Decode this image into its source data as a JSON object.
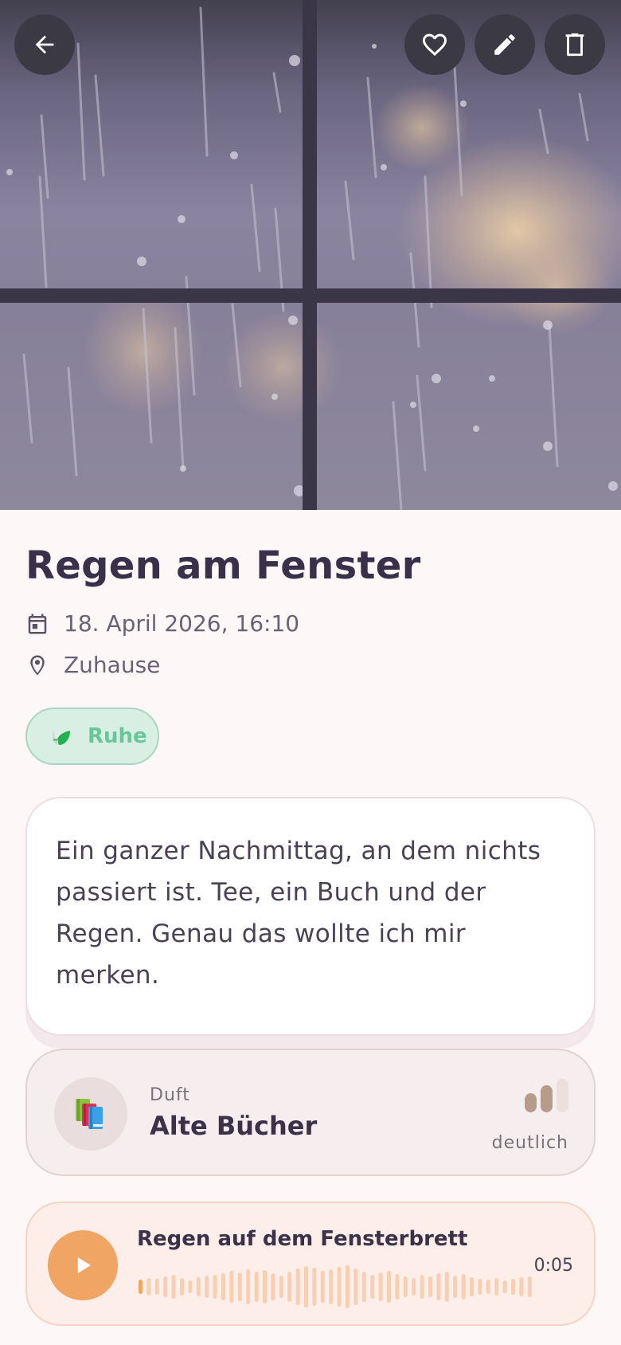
{
  "header": {
    "back_icon": "arrow-left-icon",
    "favorite_icon": "heart-outline-icon",
    "edit_icon": "pencil-icon",
    "delete_icon": "trash-icon"
  },
  "memory": {
    "title": "Regen am Fenster",
    "date": "18. April 2026, 16:10",
    "place": "Zuhause",
    "mood_tag": "Ruhe",
    "note": "Ein ganzer Nachmittag, an dem nichts passiert ist. Tee, ein Buch und der Regen. Genau das wollte ich mir merken."
  },
  "scent": {
    "kind_label": "Duft",
    "name": "Alte Bücher",
    "intensity_label": "deutlich",
    "intensity_level": 2,
    "intensity_max": 3
  },
  "audio": {
    "title": "Regen auf dem Fensterbrett",
    "duration": "0:05",
    "progress": 0.02
  },
  "colors": {
    "accent_orange": "#f0a564",
    "tag_green": "#6bc59a",
    "title_text": "#3a3049"
  }
}
